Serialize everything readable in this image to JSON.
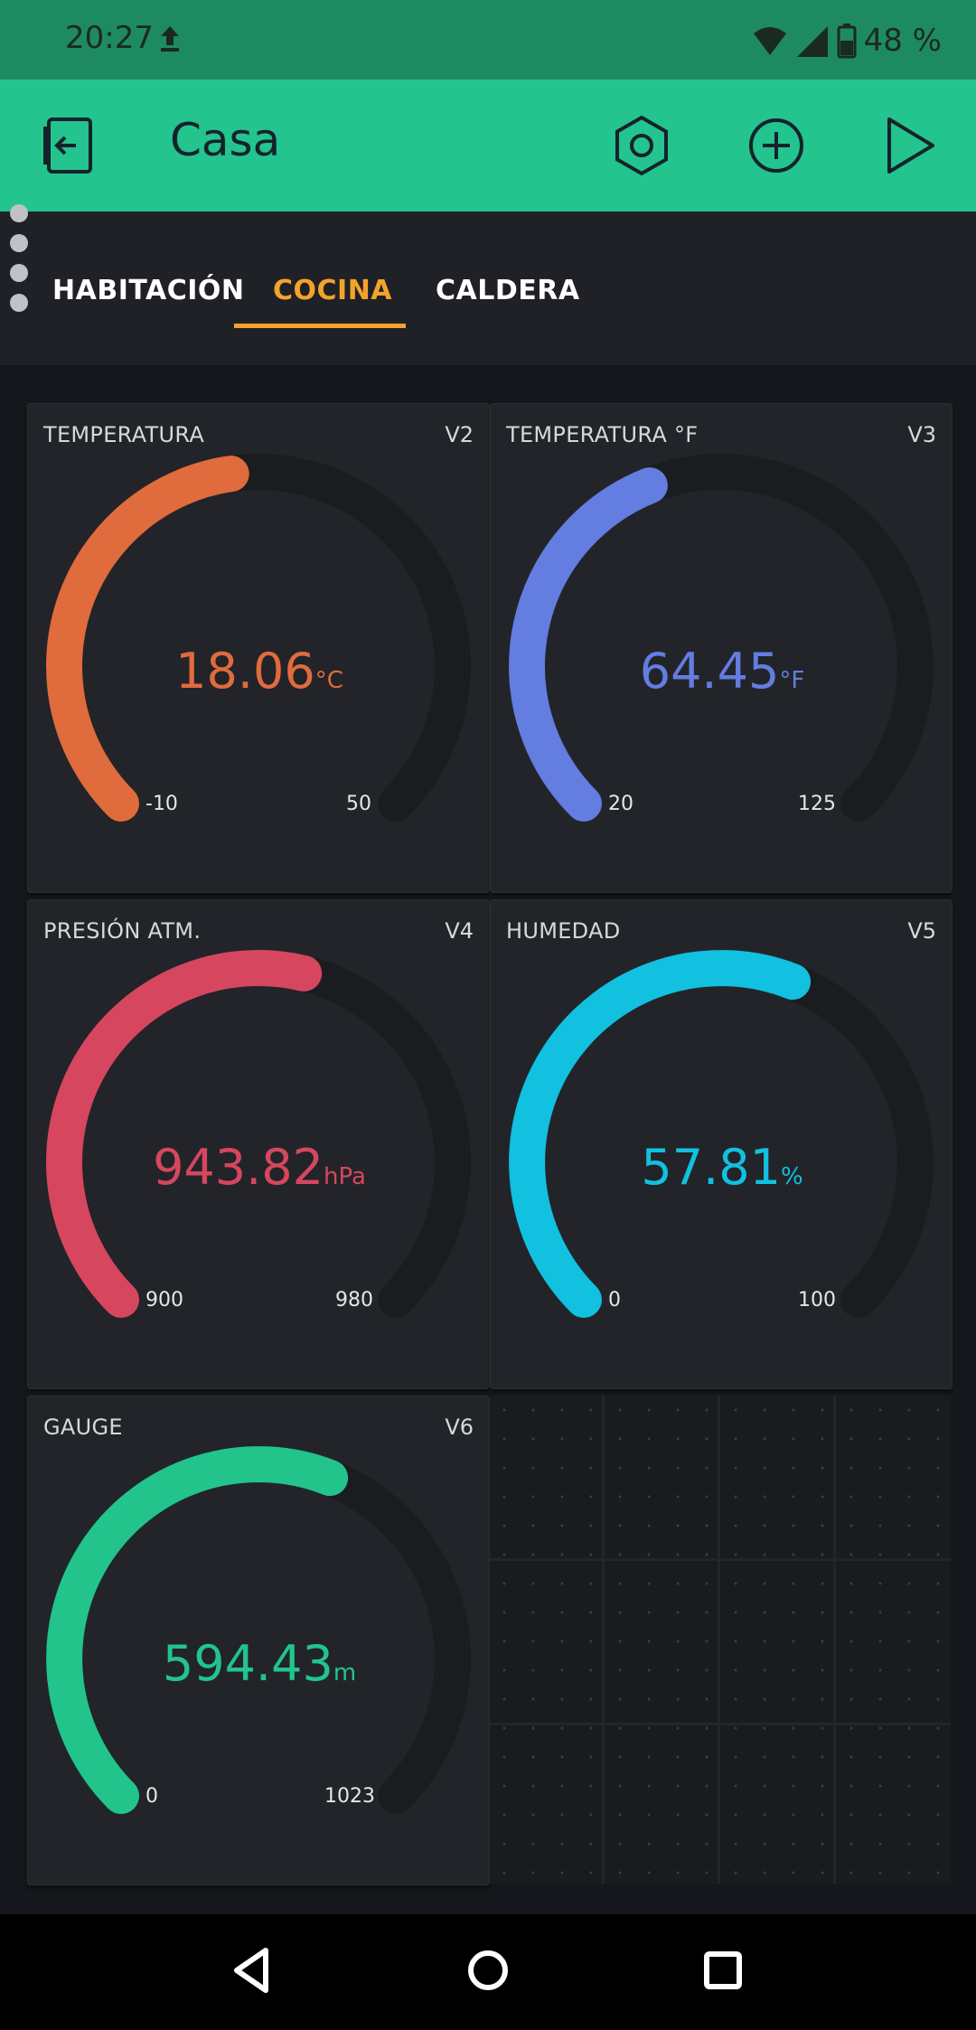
{
  "status": {
    "time": "20:27",
    "battery": "48 %"
  },
  "app": {
    "title": "Casa"
  },
  "tabs": [
    {
      "label": "HABITACIÓN"
    },
    {
      "label": "COCINA",
      "active": true
    },
    {
      "label": "CALDERA"
    }
  ],
  "widgets": [
    {
      "title": "TEMPERATURA",
      "pin": "V2",
      "value": "18.06",
      "unit": "°C",
      "min": "-10",
      "max": "50",
      "level": 0.47,
      "color": "#e06b3c"
    },
    {
      "title": "TEMPERATURA °F",
      "pin": "V3",
      "value": "64.45",
      "unit": "°F",
      "min": "20",
      "max": "125",
      "level": 0.42,
      "color": "#637de0"
    },
    {
      "title": "PRESIÓN ATM.",
      "pin": "V4",
      "value": "943.82",
      "unit": "hPa",
      "min": "900",
      "max": "980",
      "level": 0.55,
      "color": "#d6465f"
    },
    {
      "title": "HUMEDAD",
      "pin": "V5",
      "value": "57.81",
      "unit": "%",
      "min": "0",
      "max": "100",
      "level": 0.58,
      "color": "#12c0e0"
    },
    {
      "title": "GAUGE",
      "pin": "V6",
      "value": "594.43",
      "unit": "m",
      "min": "0",
      "max": "1023",
      "level": 0.58,
      "color": "#22c48c"
    }
  ],
  "icons": {
    "upload": "upload-icon",
    "wifi": "wifi-icon",
    "signal": "signal-icon",
    "battery": "battery-icon",
    "back_project": "exit-project-icon",
    "settings": "settings-hexagon-icon",
    "add": "add-widget-icon",
    "play": "play-icon",
    "nav_back": "nav-back-icon",
    "nav_home": "nav-home-icon",
    "nav_recents": "nav-recents-icon"
  }
}
